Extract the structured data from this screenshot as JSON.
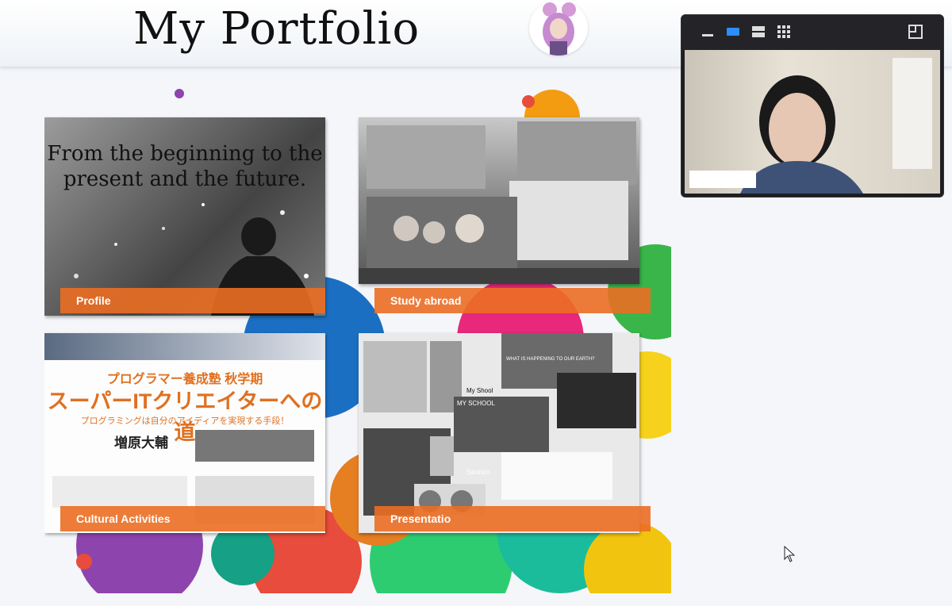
{
  "header": {
    "title": "My Portfolio"
  },
  "tiles": {
    "profile": {
      "label": "Profile",
      "headline_1": "From the beginning to the",
      "headline_2": "present and the future."
    },
    "study_abroad": {
      "label": "Study abroad"
    },
    "cultural": {
      "label": "Cultural Activities",
      "jp_line_1": "プログラマー養成塾 秋学期",
      "jp_line_2": "スーパーITクリエイターへの道",
      "jp_line_3": "プログラミングは自分のアイディアを実現する手段！",
      "jp_name": "増原大輔"
    },
    "presentation": {
      "label": "Presentatio",
      "tag_my_shool": "My Shool",
      "tag_my_school": "MY SCHOOL",
      "tag_sexism": "Sexism",
      "tag_what": "WHAT IS HAPPENING TO OUR EARTH?"
    }
  },
  "video": {
    "participant_name": ""
  },
  "colors": {
    "accent_orange": "#eb6e23",
    "video_bg": "#1e1e22",
    "active_control": "#2d8cff"
  },
  "icons": [
    "minimize-icon",
    "speaker-view-icon",
    "gallery-strip-icon",
    "gallery-grid-icon",
    "exit-fullscreen-icon",
    "cursor-icon"
  ]
}
